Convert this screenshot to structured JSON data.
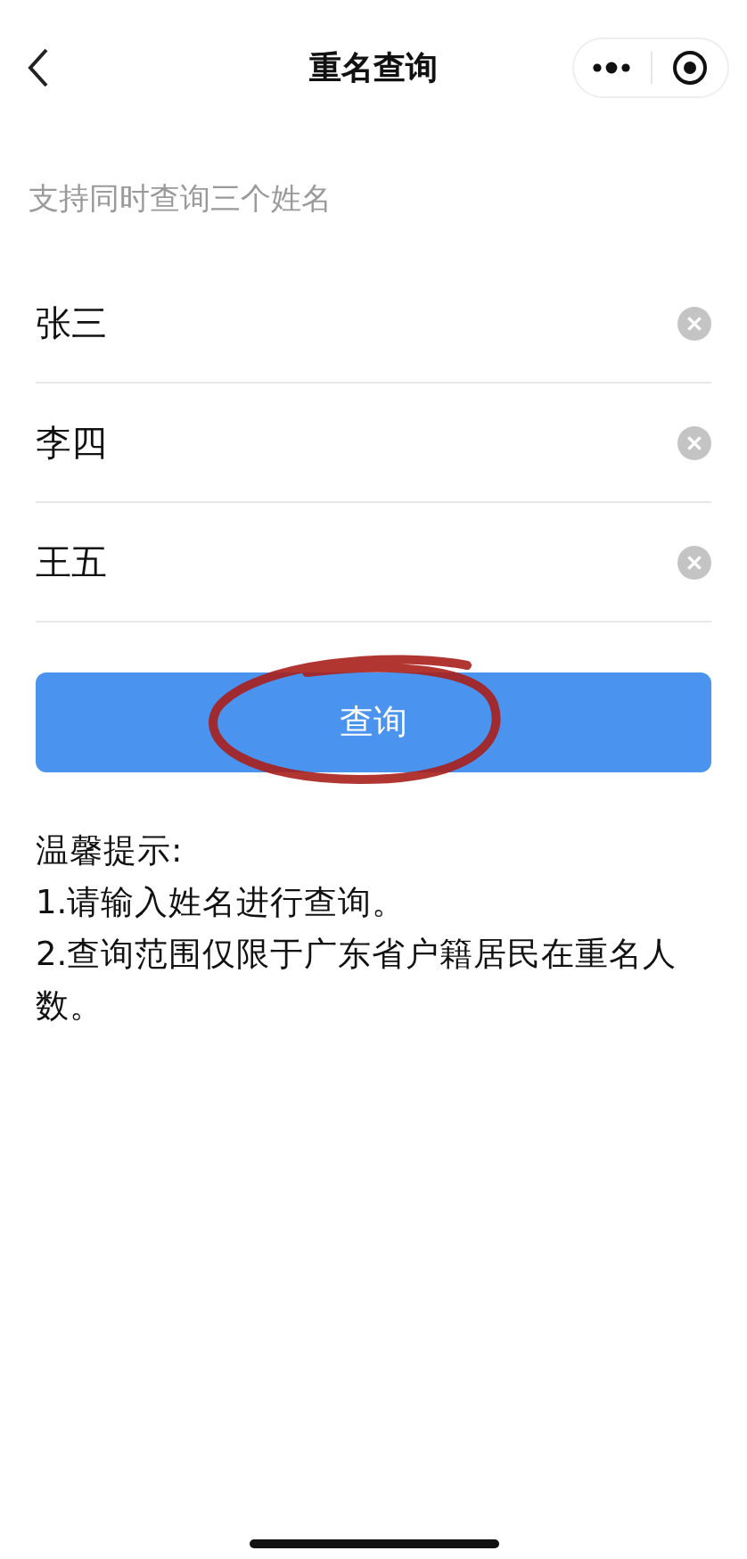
{
  "nav_bar": {
    "title": "重名查询"
  },
  "hint": "支持同时查询三个姓名",
  "name_fields": [
    {
      "value": "张三"
    },
    {
      "value": "李四"
    },
    {
      "value": "王五"
    }
  ],
  "query_button": {
    "label": "查询"
  },
  "tips": {
    "heading": "温馨提示:",
    "lines": [
      "1.请输入姓名进行查询。",
      "2.查询范围仅限于广东省户籍居民在重名人数。"
    ]
  }
}
